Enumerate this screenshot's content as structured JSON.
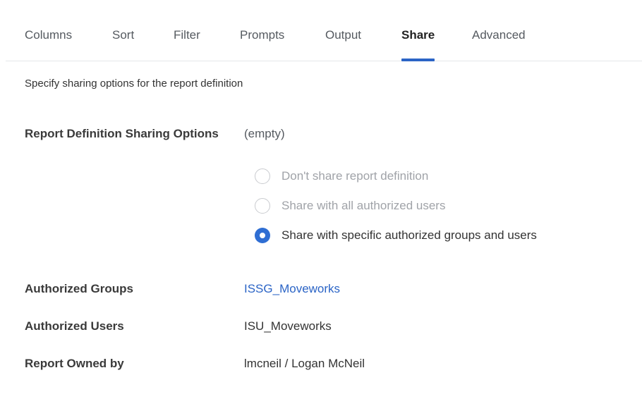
{
  "tabs": [
    {
      "label": "Columns",
      "active": false
    },
    {
      "label": "Sort",
      "active": false
    },
    {
      "label": "Filter",
      "active": false
    },
    {
      "label": "Prompts",
      "active": false
    },
    {
      "label": "Output",
      "active": false
    },
    {
      "label": "Share",
      "active": true
    },
    {
      "label": "Advanced",
      "active": false
    }
  ],
  "intro_text": "Specify sharing options for the report definition",
  "sharing": {
    "label": "Report Definition Sharing Options",
    "value": "(empty)",
    "options": [
      {
        "label": "Don't share report definition",
        "selected": false
      },
      {
        "label": "Share with all authorized users",
        "selected": false
      },
      {
        "label": "Share with specific authorized groups and users",
        "selected": true
      }
    ]
  },
  "authorized_groups": {
    "label": "Authorized Groups",
    "value": "ISSG_Moveworks"
  },
  "authorized_users": {
    "label": "Authorized Users",
    "value": "ISU_Moveworks"
  },
  "report_owner": {
    "label": "Report Owned by",
    "value": "lmcneil / Logan McNeil"
  },
  "colors": {
    "accent": "#2b64c6",
    "radio_selected": "#2f6ed3",
    "disabled_text": "#a0a3a8"
  }
}
